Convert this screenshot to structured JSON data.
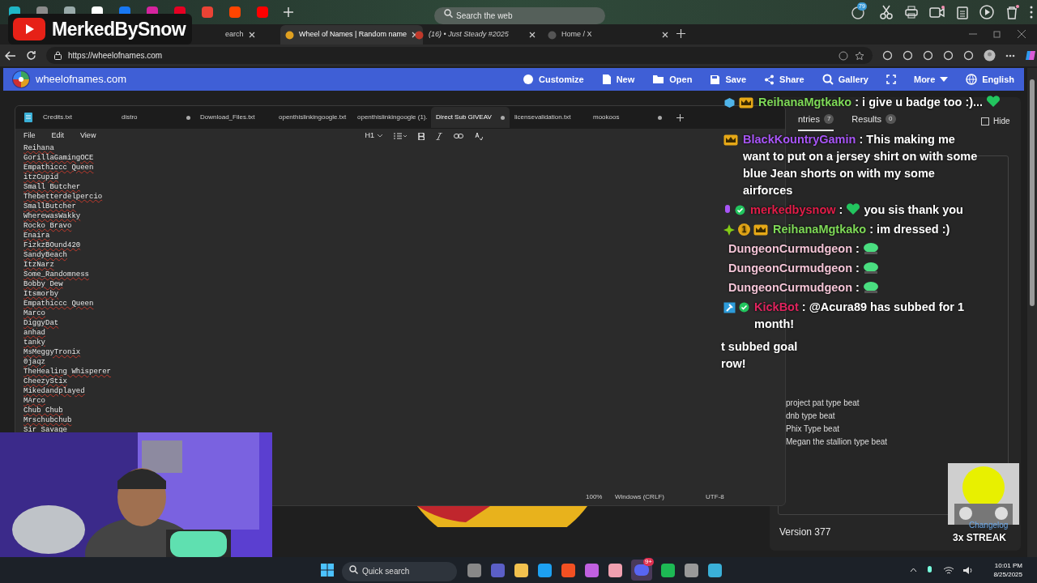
{
  "overlay_banner": {
    "channel": "MerkedBySnow"
  },
  "browser": {
    "search": {
      "placeholder": "Search the web"
    },
    "notification_count": "79",
    "tabs": [
      {
        "title": "earch",
        "selected": false
      },
      {
        "title": "Wheel of Names | Random name",
        "selected": true
      },
      {
        "title": "(16) • Just Steady #2025",
        "selected": false
      },
      {
        "title": "Home / X",
        "selected": false
      }
    ],
    "address": "https://wheelofnames.com"
  },
  "site": {
    "name": "wheelofnames.com",
    "nav": [
      {
        "label": "Customize"
      },
      {
        "label": "New"
      },
      {
        "label": "Open"
      },
      {
        "label": "Save"
      },
      {
        "label": "Share"
      },
      {
        "label": "Gallery"
      },
      {
        "label": "More"
      },
      {
        "label": "English"
      }
    ],
    "panel": {
      "tabs": [
        {
          "label": "ntries",
          "count": "7",
          "selected": true
        },
        {
          "label": "Results",
          "count": "0",
          "selected": false
        }
      ],
      "hide": {
        "label": "Hide",
        "checked": false
      },
      "entries": [
        "project pat type beat",
        "dnb type beat",
        "Phix Type beat",
        "Megan the stallion type beat"
      ],
      "version": "Version 377",
      "changelog": "Changelog"
    }
  },
  "notepad": {
    "tabs": [
      {
        "title": "Credits.txt",
        "modified": false,
        "selected": false
      },
      {
        "title": "distro",
        "modified": true,
        "selected": false
      },
      {
        "title": "Download_Files.txt",
        "modified": false,
        "selected": false
      },
      {
        "title": "openthislinkingoogle.txt",
        "modified": false,
        "selected": false
      },
      {
        "title": "openthislinkingoogle (1).",
        "modified": false,
        "selected": false
      },
      {
        "title": "Direct Sub GIVEAV",
        "modified": true,
        "selected": true
      },
      {
        "title": "licensevalidation.txt",
        "modified": false,
        "selected": false
      },
      {
        "title": "mookoos",
        "modified": true,
        "selected": false
      }
    ],
    "menu": [
      "File",
      "Edit",
      "View"
    ],
    "heading": "H1",
    "lines": [
      "Reihana",
      "GorillaGamingOCE",
      "Empathiccc Queen",
      "itzCupid",
      "Small Butcher",
      "Thebetterdelpercio",
      "SmallButcher",
      "WherewasWakky",
      "Rocko Bravo",
      "Enaira",
      "FizkzBOund420",
      "SandyBeach",
      "ItzNarz",
      "Some_Randomness",
      "Bobby Dew",
      "Itsmorby",
      "Empathiccc Queen",
      "Marco",
      "DiggyDat",
      "anhad",
      "tanky",
      "MsMeggyTronix",
      "0jaqz",
      "TheHealing Whisperer",
      "CheezyStix",
      "Mikedandplayed",
      "MArco",
      "Chub Chub",
      "Mrschubchub",
      "Sir Savage"
    ],
    "status": [
      "100%",
      "Windows (CRLF)",
      "UTF-8"
    ]
  },
  "chat": [
    {
      "kind": "message",
      "badges": [
        {
          "kind": "cube"
        },
        {
          "kind": "crown"
        }
      ],
      "user": "ReihanaMgtkako",
      "color": "#7ed957",
      "separator": ":",
      "text": "i give u badge too :)..."
    },
    {
      "kind": "message",
      "badges": [
        {
          "kind": "crown"
        }
      ],
      "user": "BlackKountryGamin",
      "color": "#a855f7",
      "separator": ":",
      "text": "This making me want to put on a jersey shirt on with some blue Jean shorts on with my some airforces"
    },
    {
      "kind": "message",
      "badges": [
        {
          "kind": "mic"
        },
        {
          "kind": "verified"
        }
      ],
      "user": "merkedbysnow",
      "color": "#e11d48",
      "separator": ":",
      "text": "you sis thank you"
    },
    {
      "kind": "message",
      "badges": [
        {
          "kind": "sparkle"
        },
        {
          "kind": "tier",
          "text": "1"
        },
        {
          "kind": "crown"
        }
      ],
      "user": "ReihanaMgtkako",
      "color": "#7ed957",
      "separator": ":",
      "text": "im dressed :)"
    },
    {
      "kind": "message",
      "user": "DungeonCurmudgeon",
      "color": "#f3c4d6",
      "separator": ":"
    },
    {
      "kind": "message",
      "user": "DungeonCurmudgeon",
      "color": "#f3c4d6",
      "separator": ":"
    },
    {
      "kind": "message",
      "user": "DungeonCurmudgeon",
      "color": "#f3c4d6",
      "separator": ":"
    },
    {
      "kind": "message",
      "badges": [
        {
          "kind": "hammer"
        },
        {
          "kind": "verified"
        }
      ],
      "user": "KickBot",
      "color": "#e0245e",
      "separator": ":",
      "text": "@Acura89 has subbed for 1 month!"
    },
    {
      "kind": "fragment",
      "text": "t subbed goal row!"
    }
  ],
  "streak": {
    "label": "3x STREAK"
  },
  "taskbar": {
    "search": {
      "placeholder": "Quick search"
    },
    "discord_badge": "9+",
    "time": "10:01 PM",
    "date": "8/25/2025"
  }
}
